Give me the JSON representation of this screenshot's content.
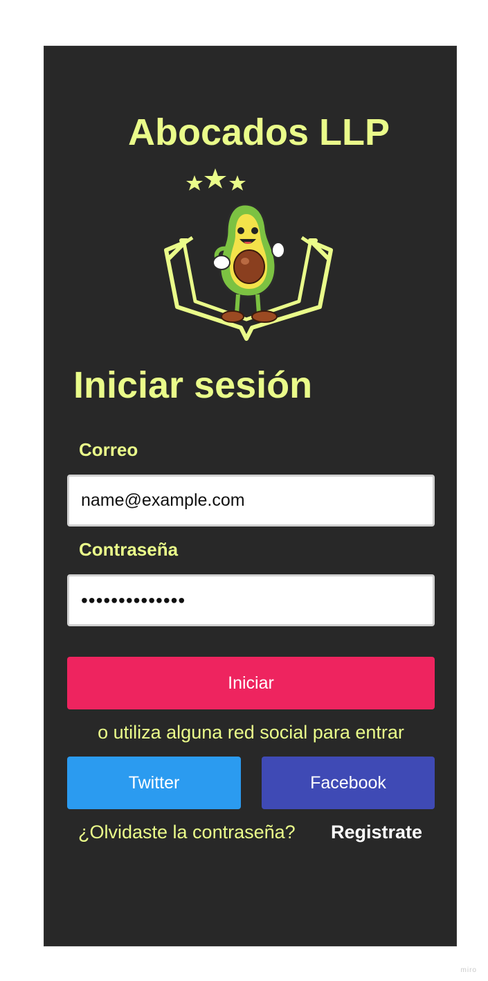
{
  "brand": {
    "title": "Abocados LLP",
    "logo_icon": "avocado-book-stars-logo"
  },
  "login": {
    "heading": "Iniciar sesión",
    "email_label": "Correo",
    "email_value": "name@example.com",
    "password_label": "Contraseña",
    "password_value": "••••••••••••••",
    "submit_label": "Iniciar",
    "social_prompt": "o utiliza alguna red social para entrar",
    "twitter_label": "Twitter",
    "facebook_label": "Facebook",
    "forgot_label": "¿Olvidaste la contraseña?",
    "register_label": "Registrate"
  },
  "footer": {
    "watermark": "miro"
  },
  "colors": {
    "background": "#282828",
    "accent": "#eafc8a",
    "primary_button": "#ee245f",
    "twitter": "#2b9bf0",
    "facebook": "#3f4ab5"
  }
}
